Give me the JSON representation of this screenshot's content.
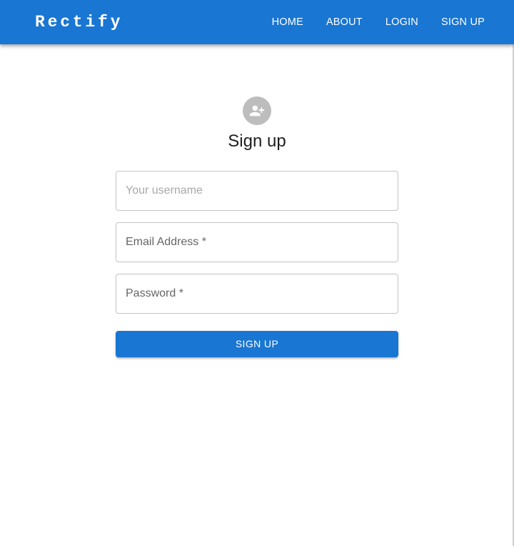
{
  "colors": {
    "primary": "#1976d2",
    "avatar_bg": "#bdbdbd",
    "field_border": "#c4c4c4"
  },
  "navbar": {
    "brand": "Rectify",
    "links": [
      {
        "label": "HOME"
      },
      {
        "label": "ABOUT"
      },
      {
        "label": "LOGIN"
      },
      {
        "label": "SIGN UP"
      }
    ]
  },
  "form": {
    "avatar_icon": "person-add-icon",
    "title": "Sign up",
    "username": {
      "placeholder": "Your username",
      "value": ""
    },
    "email": {
      "label": "Email Address *",
      "value": ""
    },
    "password": {
      "label": "Password *",
      "value": ""
    },
    "submit_label": "SIGN UP"
  }
}
